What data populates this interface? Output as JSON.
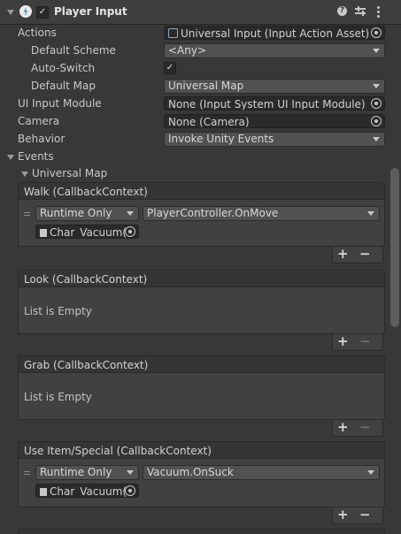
{
  "header": {
    "title": "Player Input"
  },
  "props": {
    "actions_label": "Actions",
    "actions_value": "Universal Input (Input Action Asset)",
    "default_scheme_label": "Default Scheme",
    "default_scheme_value": "<Any>",
    "auto_switch_label": "Auto-Switch",
    "auto_switch_checked": true,
    "default_map_label": "Default Map",
    "default_map_value": "Universal Map",
    "ui_input_module_label": "UI Input Module",
    "ui_input_module_value": "None (Input System UI Input Module)",
    "camera_label": "Camera",
    "camera_value": "None (Camera)",
    "behavior_label": "Behavior",
    "behavior_value": "Invoke Unity Events"
  },
  "events": {
    "label": "Events",
    "map_label": "Universal Map",
    "walk": {
      "title": "Walk (CallbackContext)",
      "mode": "Runtime Only",
      "function": "PlayerController.OnMove",
      "object": "Char_Vacuum("
    },
    "look": {
      "title": "Look (CallbackContext)",
      "empty": "List is Empty"
    },
    "grab": {
      "title": "Grab (CallbackContext)",
      "empty": "List is Empty"
    },
    "use_item": {
      "title": "Use Item/Special (CallbackContext)",
      "mode": "Runtime Only",
      "function": "Vacuum.OnSuck",
      "object": "Char_Vacuum("
    }
  },
  "glyphs": {
    "check": "✓",
    "plus": "+",
    "minus": "−"
  },
  "icons": [
    "collapse-arrow-icon",
    "component-enabled-checkbox",
    "player-input-icon",
    "help-icon",
    "preset-icon",
    "more-options-icon",
    "object-picker-icon",
    "asset-icon",
    "gameobject-icon"
  ]
}
